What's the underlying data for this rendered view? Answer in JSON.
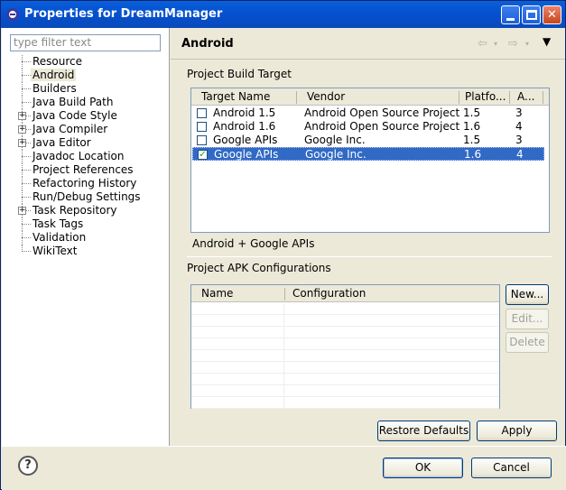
{
  "window": {
    "title": "Properties for DreamManager"
  },
  "filter": {
    "placeholder": "type filter text"
  },
  "tree": [
    {
      "label": "Resource",
      "expandable": false
    },
    {
      "label": "Android",
      "expandable": false,
      "selected": true
    },
    {
      "label": "Builders",
      "expandable": false
    },
    {
      "label": "Java Build Path",
      "expandable": false
    },
    {
      "label": "Java Code Style",
      "expandable": true
    },
    {
      "label": "Java Compiler",
      "expandable": true
    },
    {
      "label": "Java Editor",
      "expandable": true
    },
    {
      "label": "Javadoc Location",
      "expandable": false
    },
    {
      "label": "Project References",
      "expandable": false
    },
    {
      "label": "Refactoring History",
      "expandable": false
    },
    {
      "label": "Run/Debug Settings",
      "expandable": false
    },
    {
      "label": "Task Repository",
      "expandable": true
    },
    {
      "label": "Task Tags",
      "expandable": false
    },
    {
      "label": "Validation",
      "expandable": false
    },
    {
      "label": "WikiText",
      "expandable": false
    }
  ],
  "page": {
    "title": "Android",
    "back_icon": "⇦",
    "forward_icon": "⇨",
    "menu_icon": "▼"
  },
  "build_target": {
    "label": "Project Build Target",
    "columns": [
      "Target Name",
      "Vendor",
      "Platfo...",
      "A..."
    ],
    "rows": [
      {
        "name": "Android 1.5",
        "vendor": "Android Open Source Project",
        "platform": "1.5",
        "api": "3",
        "checked": false
      },
      {
        "name": "Android 1.6",
        "vendor": "Android Open Source Project",
        "platform": "1.6",
        "api": "4",
        "checked": false
      },
      {
        "name": "Google APIs",
        "vendor": "Google Inc.",
        "platform": "1.5",
        "api": "3",
        "checked": false
      },
      {
        "name": "Google APIs",
        "vendor": "Google Inc.",
        "platform": "1.6",
        "api": "4",
        "checked": true
      }
    ],
    "description": "Android + Google APIs"
  },
  "apk": {
    "label": "Project APK Configurations",
    "columns": [
      "Name",
      "Configuration"
    ],
    "buttons": {
      "new": "New...",
      "edit": "Edit...",
      "delete": "Delete"
    }
  },
  "buttons": {
    "restore": "Restore Defaults",
    "apply": "Apply",
    "ok": "OK",
    "cancel": "Cancel",
    "help": "?"
  }
}
